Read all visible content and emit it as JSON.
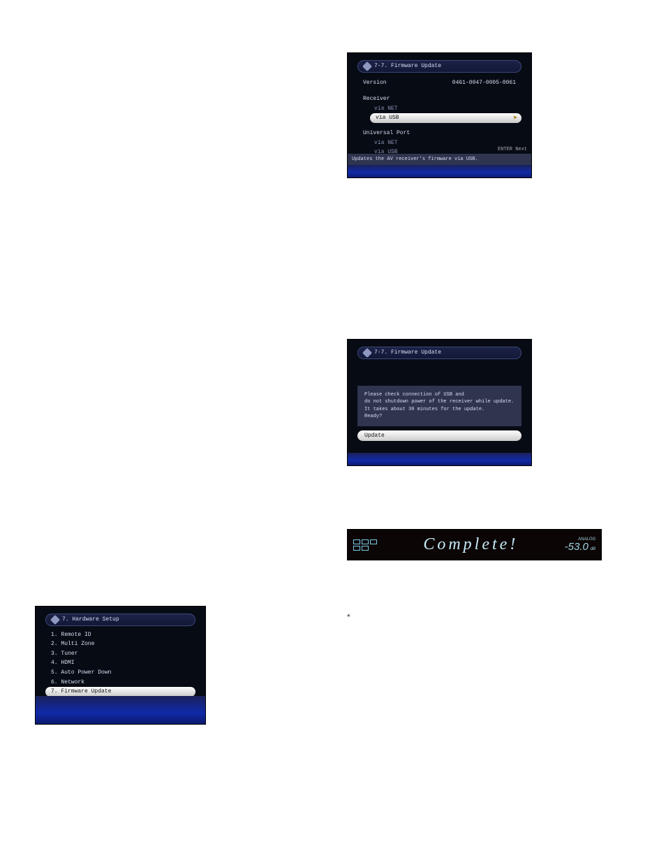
{
  "panel1": {
    "title": "7-7. Firmware Update",
    "version_label": "Version",
    "version_value": "0461-0047-0005-0061",
    "group_receiver": "Receiver",
    "item_via_net": "via NET",
    "item_via_usb": "via USB",
    "group_uport": "Universal Port",
    "hint_right": "ENTER   Next",
    "hint_text": "Updates the AV receiver's firmware via USB."
  },
  "panel2": {
    "title": "7-7. Firmware Update",
    "msg_line1": "Please check connection of USB and",
    "msg_line2": "do not shutdown power of the receiver while update.",
    "msg_line3": "It takes about 30 minutes for the update.",
    "msg_line4": "Ready?",
    "update_btn": "Update"
  },
  "fpd": {
    "main": "Complete!",
    "analog_label": "ANALOG",
    "volume": "-53.0",
    "db": "dB"
  },
  "panel3": {
    "title": "7. Hardware Setup",
    "items": [
      "1. Remote ID",
      "2. Multi Zone",
      "3. Tuner",
      "4. HDMI",
      "5. Auto Power Down",
      "6. Network",
      "7. Firmware Update"
    ],
    "selected_index": 6
  },
  "asterisk": "*"
}
